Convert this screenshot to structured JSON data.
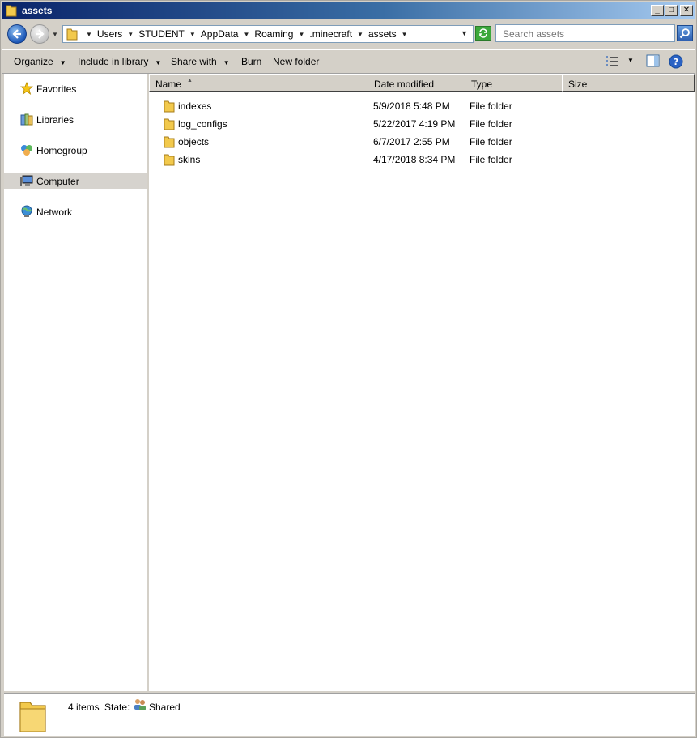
{
  "window": {
    "title": "assets",
    "minimize_glyph": "_",
    "maximize_glyph": "□",
    "close_glyph": "✕"
  },
  "address": {
    "breadcrumbs": [
      "Users",
      "STUDENT",
      "AppData",
      "Roaming",
      ".minecraft",
      "assets"
    ],
    "search_placeholder": "Search assets"
  },
  "toolbar": {
    "organize": "Organize",
    "include_in_library": "Include in library",
    "share_with": "Share with",
    "burn": "Burn",
    "new_folder": "New folder"
  },
  "nav": {
    "items": [
      {
        "label": "Favorites",
        "icon": "star-icon"
      },
      {
        "label": "Libraries",
        "icon": "libraries-icon"
      },
      {
        "label": "Homegroup",
        "icon": "homegroup-icon"
      },
      {
        "label": "Computer",
        "icon": "computer-icon",
        "selected": true
      },
      {
        "label": "Network",
        "icon": "network-icon"
      }
    ]
  },
  "columns": {
    "name": "Name",
    "date_modified": "Date modified",
    "type": "Type",
    "size": "Size"
  },
  "files": [
    {
      "name": "indexes",
      "date": "5/9/2018 5:48 PM",
      "type": "File folder"
    },
    {
      "name": "log_configs",
      "date": "5/22/2017 4:19 PM",
      "type": "File folder"
    },
    {
      "name": "objects",
      "date": "6/7/2017 2:55 PM",
      "type": "File folder"
    },
    {
      "name": "skins",
      "date": "4/17/2018 8:34 PM",
      "type": "File folder"
    }
  ],
  "status": {
    "item_count": "4 items",
    "state_label": "State:",
    "state_value": "Shared"
  },
  "colors": {
    "title_gradient_start": "#0a246a",
    "title_gradient_end": "#a6caf0",
    "chrome": "#d4d0c8",
    "folder_yellow": "#f2c94c",
    "selected_nav": "#d6d3ce"
  }
}
